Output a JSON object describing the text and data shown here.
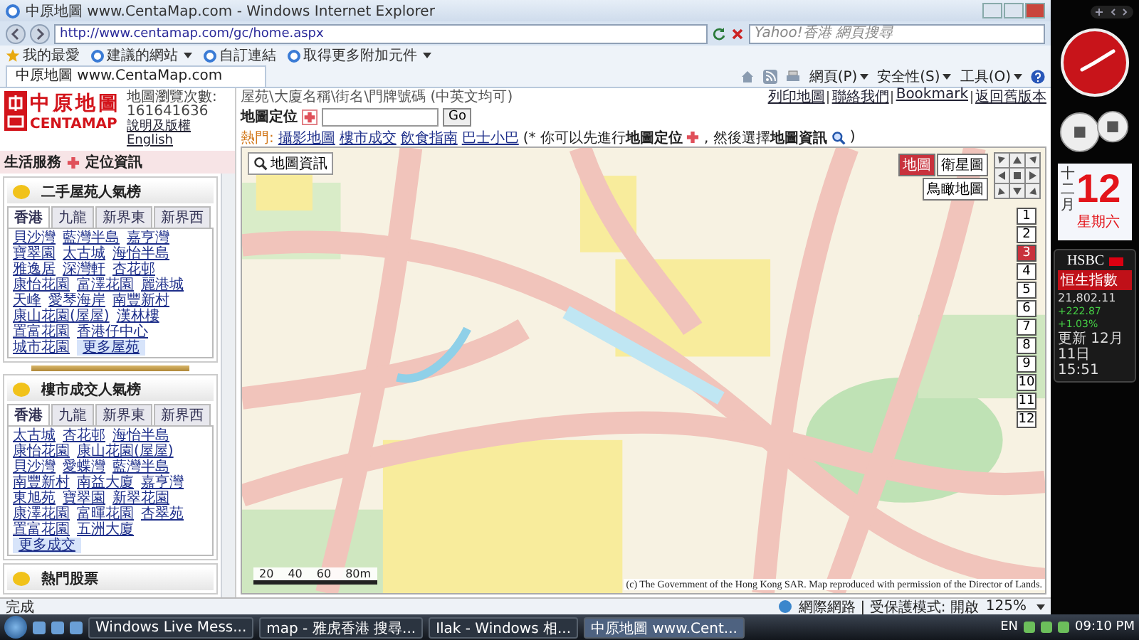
{
  "window": {
    "title": "中原地圖 www.CentaMap.com - Windows Internet Explorer"
  },
  "address_bar": {
    "value": "http://www.centamap.com/gc/home.aspx"
  },
  "search": {
    "placeholder": "Yahoo!香港 網頁搜尋"
  },
  "favorites_bar": [
    {
      "label": "我的最愛",
      "kind": "star",
      "dropdown": false
    },
    {
      "label": "建議的網站",
      "kind": "page",
      "dropdown": true
    },
    {
      "label": "自訂連結",
      "kind": "page",
      "dropdown": false
    },
    {
      "label": "取得更多附加元件",
      "kind": "page",
      "dropdown": true
    }
  ],
  "tabs": [
    {
      "label": "中原地圖 www.CentaMap.com",
      "selected": true
    }
  ],
  "command_bar": [
    "網頁(P)",
    "安全性(S)",
    "工具(O)"
  ],
  "site_header": {
    "logo_cn": "中原地圖",
    "logo_en": "CENTAMAP",
    "visits_label": "地圖瀏覽次數:",
    "visits": "161641636",
    "links": [
      "說明及版權",
      "English"
    ]
  },
  "nav": [
    "生活服務",
    "定位資訊"
  ],
  "rankings": [
    {
      "title": "二手屋苑人氣榜",
      "tabs": [
        {
          "label": "香港",
          "selected": true
        },
        {
          "label": "九龍",
          "selected": false
        },
        {
          "label": "新界東",
          "selected": false
        },
        {
          "label": "新界西",
          "selected": false
        }
      ],
      "links": [
        "貝沙灣",
        "藍灣半島",
        "嘉亨灣",
        "寶翠園",
        "太古城",
        "海怡半島",
        "雅逸居",
        "深灣軒",
        "杏花邨",
        "康怡花園",
        "富澤花園",
        "麗港城",
        "天峰",
        "愛琴海岸",
        "南豐新村",
        "康山花園(屋屋)",
        "漢林樓",
        "置富花園",
        "香港仔中心",
        "城市花園"
      ],
      "more": "更多屋苑"
    },
    {
      "title": "樓市成交人氣榜",
      "tabs": [
        {
          "label": "香港",
          "selected": true
        },
        {
          "label": "九龍",
          "selected": false
        },
        {
          "label": "新界東",
          "selected": false
        },
        {
          "label": "新界西",
          "selected": false
        }
      ],
      "links": [
        "太古城",
        "杏花邨",
        "海怡半島",
        "康怡花園",
        "康山花園(屋屋)",
        "貝沙灣",
        "愛蝶灣",
        "藍灣半島",
        "南豐新村",
        "南益大廈",
        "嘉亨灣",
        "東旭苑",
        "寶翠園",
        "新翠花園",
        "康澤花園",
        "富暉花園",
        "杏翠苑",
        "置富花園",
        "五洲大廈"
      ],
      "more": "更多成交"
    }
  ],
  "hot_panel": {
    "title": "熱門股票"
  },
  "search_hint": "屋苑\\大廈名稱\\街名\\門牌號碼 (中英文均可)",
  "top_links": [
    "列印地圖",
    "聯絡我們",
    "Bookmark",
    "返回舊版本"
  ],
  "locate": {
    "label": "地圖定位",
    "button": "Go"
  },
  "hot_line": {
    "label": "熱門:",
    "links": [
      "攝影地圖",
      "樓市成交",
      "飲食指南",
      "巴士小巴"
    ],
    "note_start": "(* 你可以先進行**地圖定位**",
    "note_middle": ", 然後選擇**地圖資訊**",
    "note_end": ")"
  },
  "map": {
    "info_button": "地圖資訊",
    "modes": [
      {
        "label": "地圖",
        "selected": true
      },
      {
        "label": "衛星圖",
        "selected": false
      },
      {
        "label": "鳥瞰地圖",
        "selected": false
      }
    ],
    "zoom_levels": [
      {
        "label": "1",
        "selected": false
      },
      {
        "label": "2",
        "selected": false
      },
      {
        "label": "3",
        "selected": true
      },
      {
        "label": "4",
        "selected": false
      },
      {
        "label": "5",
        "selected": false
      },
      {
        "label": "6",
        "selected": false
      },
      {
        "label": "7",
        "selected": false
      },
      {
        "label": "8",
        "selected": false
      },
      {
        "label": "9",
        "selected": false
      },
      {
        "label": "10",
        "selected": false
      },
      {
        "label": "11",
        "selected": false
      },
      {
        "label": "12",
        "selected": false
      }
    ],
    "scale": [
      "20",
      "40",
      "60",
      "80m"
    ],
    "copyright": "(c) The Government of the Hong Kong SAR. Map reproduced with permission of the Director of Lands."
  },
  "status_bar": {
    "text": "完成",
    "zone": "網際網路 | 受保護模式: 開啟",
    "zoom": "125%"
  },
  "taskbar": {
    "buttons": [
      {
        "label": "Windows Live Mess...",
        "selected": false
      },
      {
        "label": "map - 雅虎香港 搜尋...",
        "selected": false
      },
      {
        "label": "Ilak - Windows 相...",
        "selected": false
      },
      {
        "label": "中原地圖 www.Cent...",
        "selected": true
      }
    ],
    "language": "EN",
    "clock": "09:10 PM"
  },
  "gadgets": {
    "calendar": {
      "day": "12",
      "month": "十二月",
      "weekday": "星期六"
    },
    "stock": {
      "brand": "HSBC",
      "index": "恒生指數",
      "value": "21,802.11",
      "change": "+222.87",
      "percent": "+1.03%",
      "updated": "更新 12月 11日 15:51"
    }
  }
}
